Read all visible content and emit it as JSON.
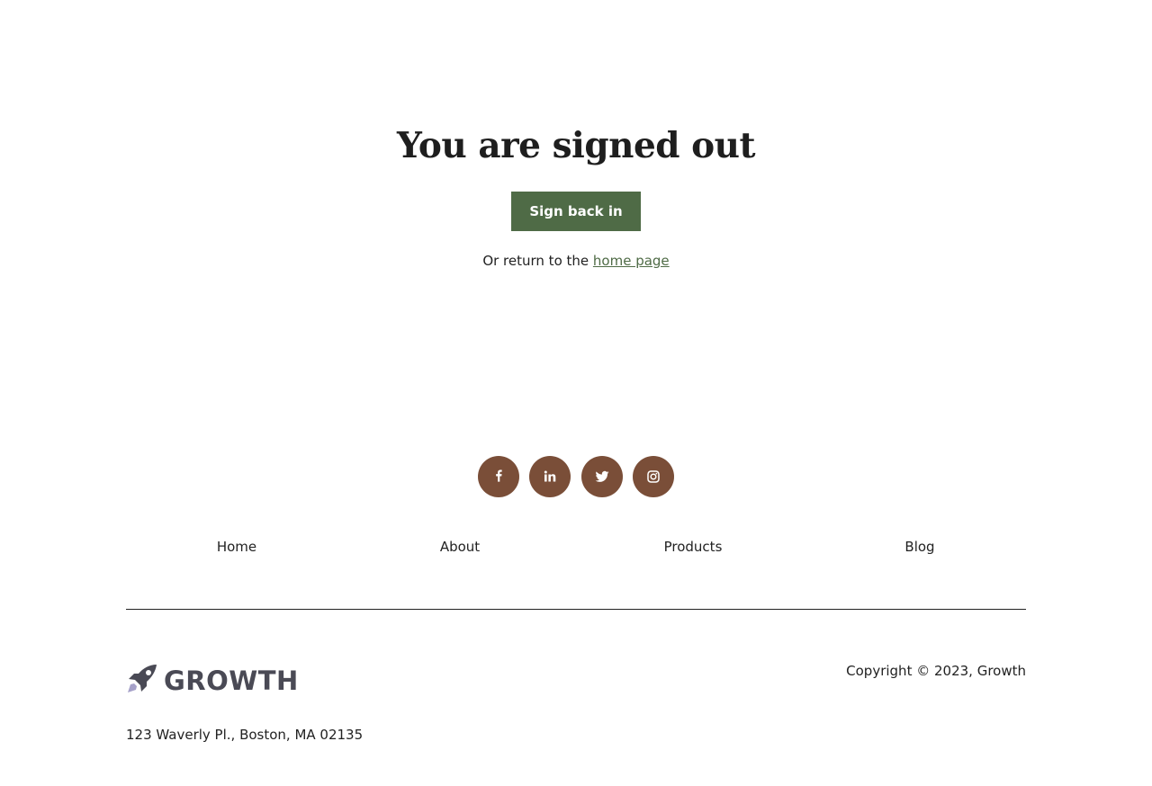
{
  "main": {
    "title": "You are signed out",
    "signin_button": "Sign back in",
    "return_prefix": "Or return to the ",
    "return_link": "home page"
  },
  "colors": {
    "accent_green": "#4f6b46",
    "social_brown": "#7a4e38",
    "logo_gray": "#4a4a55"
  },
  "footer": {
    "social": [
      {
        "icon": "facebook-icon"
      },
      {
        "icon": "linkedin-icon"
      },
      {
        "icon": "twitter-icon"
      },
      {
        "icon": "instagram-icon"
      }
    ],
    "nav": [
      "Home",
      "About",
      "Products",
      "Blog"
    ],
    "logo_text": "GROWTH",
    "copyright": "Copyright © 2023, Growth",
    "address": "123 Waverly Pl., Boston, MA 02135"
  }
}
